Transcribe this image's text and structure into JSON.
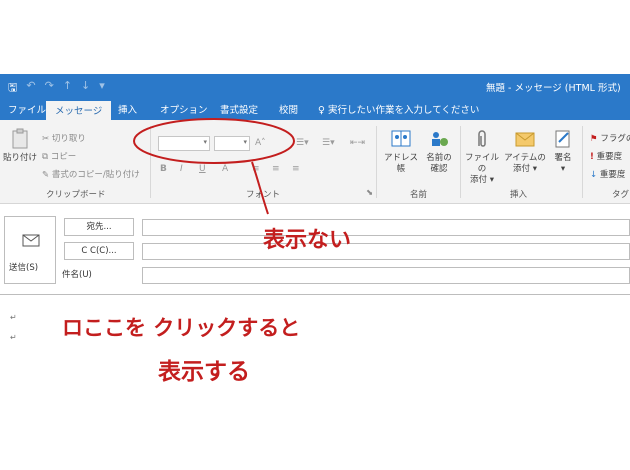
{
  "qat": {
    "save_icon": "save-icon",
    "undo_icon": "undo-icon",
    "redo_icon": "redo-icon",
    "up_icon": "up-arrow-icon",
    "down_icon": "down-arrow-icon",
    "custom_icon": "customize-icon"
  },
  "window": {
    "title": "無題 - メッセージ (HTML 形式)"
  },
  "tabs": [
    {
      "label": "ファイル"
    },
    {
      "label": "メッセージ"
    },
    {
      "label": "挿入"
    },
    {
      "label": "オプション"
    },
    {
      "label": "書式設定"
    },
    {
      "label": "校閲"
    }
  ],
  "tellme": {
    "label": "実行したい作業を入力してください"
  },
  "ribbon": {
    "clipboard": {
      "paste": "貼り付け",
      "cut": "切り取り",
      "copy": "コピー",
      "format_painter": "書式のコピー/貼り付け",
      "label": "クリップボード"
    },
    "font": {
      "bold": "B",
      "italic": "I",
      "underline": "U",
      "grow": "A",
      "label": "フォント"
    },
    "names": {
      "address_book": "アドレス帳",
      "check_names_1": "名前の",
      "check_names_2": "確認",
      "label": "名前"
    },
    "insert": {
      "attach_file_1": "ファイルの",
      "attach_file_2": "添付",
      "attach_item_1": "アイテムの",
      "attach_item_2": "添付",
      "signature": "署名",
      "label": "挿入"
    },
    "tags": {
      "flag": "フラグの",
      "high": "重要度",
      "low": "重要度",
      "label": "タグ"
    }
  },
  "compose": {
    "send": "送信(S)",
    "to": "宛先...",
    "cc": "C C(C)...",
    "subject": "件名(U)"
  },
  "annotations": {
    "not_shown": "表示ない",
    "click_here_1": "ロここを クリックすると",
    "click_here_2": "表示する"
  },
  "colors": {
    "accent": "#2b79c9",
    "annotation": "#c31e1e"
  }
}
